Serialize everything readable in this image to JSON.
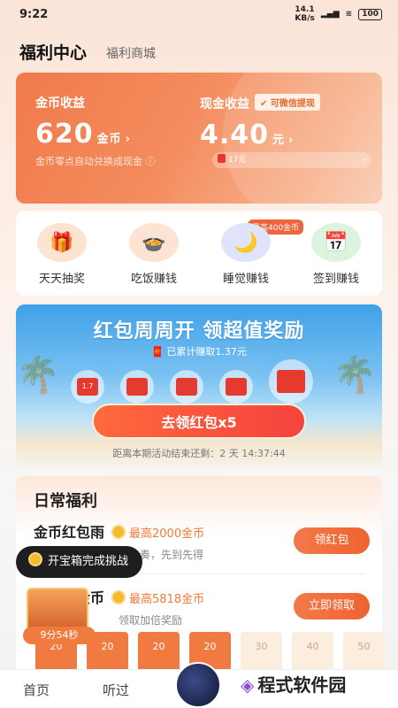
{
  "status": {
    "time": "9:22",
    "net": "14.1\nKB/s",
    "battery": "100"
  },
  "header": {
    "title": "福利中心",
    "shop": "福利商城"
  },
  "earnings": {
    "coin_label": "金币收益",
    "coin_value": "620",
    "coin_unit": "金币",
    "cash_label": "现金收益",
    "cash_badge": "可微信提现",
    "cash_value": "4.40",
    "cash_unit": "元",
    "note": "金币零点自动兑换成现金",
    "pill_text": "17元"
  },
  "shortcuts": [
    {
      "label": "天天抽奖",
      "icon": "gift-icon"
    },
    {
      "label": "吃饭赚钱",
      "icon": "rice-bowl-icon"
    },
    {
      "label": "睡觉赚钱",
      "icon": "moon-icon"
    },
    {
      "label": "签到赚钱",
      "icon": "calendar-icon"
    }
  ],
  "shortcut_tag": "最高400金币",
  "promo": {
    "headline": "红包周周开 领超值奖励",
    "earned": "已累计赚取1.37元",
    "first_env": "1.7",
    "button": "去领红包x5",
    "countdown": "距离本期活动结束还剩：2 天 14:37:44"
  },
  "daily": {
    "title": "日常福利",
    "tasks": [
      {
        "name": "金币红包雨",
        "max": "最高2000金币",
        "desc": "奏，先到先得",
        "button": "领红包"
      },
      {
        "name": "听书赚金币",
        "max": "最高5818金币",
        "desc": "领取加倍奖励",
        "button": "立即领取"
      }
    ]
  },
  "tooltip": "开宝箱完成挑战",
  "chest_timer": "9分54秒",
  "coin_cells": [
    "20",
    "20",
    "20",
    "20",
    "30",
    "40",
    "50"
  ],
  "tabs": {
    "home": "首页",
    "listen": "听过"
  },
  "watermark": "程式软件园",
  "colors": {
    "accent": "#f0643a",
    "promo_blue": "#3fa1e8"
  }
}
